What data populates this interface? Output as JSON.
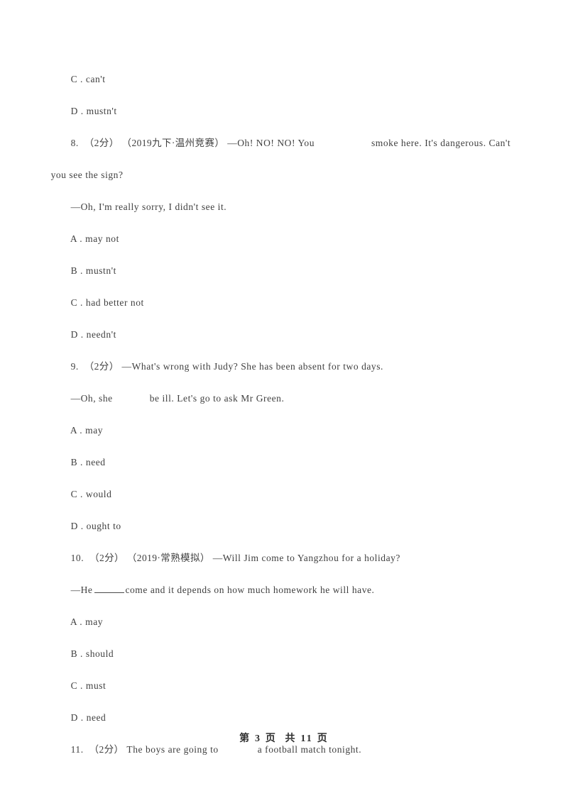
{
  "document": {
    "page_footer": "第 3 页  共 11 页",
    "background_color": "#ffffff",
    "text_color": "#3f3f3f"
  },
  "lines": [
    {
      "id": "q7-option-c",
      "text": "C . can't"
    },
    {
      "id": "q7-option-d",
      "text": "D . mustn't"
    },
    {
      "id": "q8-stem-part1",
      "number": "8.",
      "marks": "（2分）",
      "tag": "（2019九下·温州竞赛）",
      "text_before_blank": "—Oh! NO! NO! You",
      "text_after_blank": "smoke here. It's dangerous. Can't"
    },
    {
      "id": "q8-stem-part2",
      "text": "you see the sign?"
    },
    {
      "id": "q8-reply",
      "text": "—Oh, I'm really sorry, I didn't see it."
    },
    {
      "id": "q8-option-a",
      "text": "A . may not"
    },
    {
      "id": "q8-option-b",
      "text": "B . mustn't"
    },
    {
      "id": "q8-option-c",
      "text": "C . had better not"
    },
    {
      "id": "q8-option-d",
      "text": "D . needn't"
    },
    {
      "id": "q9-stem",
      "number": "9.",
      "marks": "（2分）",
      "text": "—What's wrong with Judy? She has been absent for two days."
    },
    {
      "id": "q9-reply",
      "text_before_blank": "—Oh, she",
      "text_after_blank": "be ill. Let's go to ask Mr Green."
    },
    {
      "id": "q9-option-a",
      "text": "A . may"
    },
    {
      "id": "q9-option-b",
      "text": "B . need"
    },
    {
      "id": "q9-option-c",
      "text": "C . would"
    },
    {
      "id": "q9-option-d",
      "text": "D . ought to"
    },
    {
      "id": "q10-stem",
      "number": "10.",
      "marks": "（2分）",
      "tag": "（2019·常熟模拟）",
      "text": "—Will Jim come to Yangzhou for a holiday?"
    },
    {
      "id": "q10-reply",
      "text_before_blank": "—He",
      "text_after_blank": "come and it depends on how much homework he will have."
    },
    {
      "id": "q10-option-a",
      "text": "A . may"
    },
    {
      "id": "q10-option-b",
      "text": "B . should"
    },
    {
      "id": "q10-option-c",
      "text": "C . must"
    },
    {
      "id": "q10-option-d",
      "text": "D . need"
    },
    {
      "id": "q11-stem",
      "number": "11.",
      "marks": "（2分）",
      "text_before_blank": "The boys are going to",
      "text_after_blank": "a football match tonight."
    }
  ],
  "questions": {
    "q7_tail": {
      "options": [
        {
          "label": "C",
          "value": "can't"
        },
        {
          "label": "D",
          "value": "mustn't"
        }
      ]
    },
    "q8": {
      "number": "8.",
      "marks": "（2分）",
      "source_tag": "（2019九下·温州竞赛）",
      "stem_line1_before_blank": "—Oh! NO! NO! You",
      "stem_line1_after_blank": "smoke here. It's dangerous. Can't",
      "stem_line2": "you see the sign?",
      "reply": "—Oh, I'm really sorry, I didn't see it.",
      "blank_style": "whitespace",
      "options": [
        {
          "label": "A",
          "value": "may not"
        },
        {
          "label": "B",
          "value": "mustn't"
        },
        {
          "label": "C",
          "value": "had better not"
        },
        {
          "label": "D",
          "value": "needn't"
        }
      ]
    },
    "q9": {
      "number": "9.",
      "marks": "（2分）",
      "stem": "—What's wrong with Judy? She has been absent for two days.",
      "reply_before_blank": "—Oh, she",
      "reply_after_blank": "be ill. Let's go to ask Mr Green.",
      "blank_style": "whitespace",
      "options": [
        {
          "label": "A",
          "value": "may"
        },
        {
          "label": "B",
          "value": "need"
        },
        {
          "label": "C",
          "value": "would"
        },
        {
          "label": "D",
          "value": "ought to"
        }
      ]
    },
    "q10": {
      "number": "10.",
      "marks": "（2分）",
      "source_tag": "（2019·常熟模拟）",
      "stem": "—Will Jim come to Yangzhou for a holiday?",
      "reply_before_blank": "—He",
      "reply_after_blank": "come and it depends on how much homework he will have.",
      "blank_style": "underscore",
      "options": [
        {
          "label": "A",
          "value": "may"
        },
        {
          "label": "B",
          "value": "should"
        },
        {
          "label": "C",
          "value": "must"
        },
        {
          "label": "D",
          "value": "need"
        }
      ]
    },
    "q11": {
      "number": "11.",
      "marks": "（2分）",
      "stem_before_blank": "The boys are going to",
      "stem_after_blank": "a football match tonight.",
      "blank_style": "whitespace"
    }
  }
}
